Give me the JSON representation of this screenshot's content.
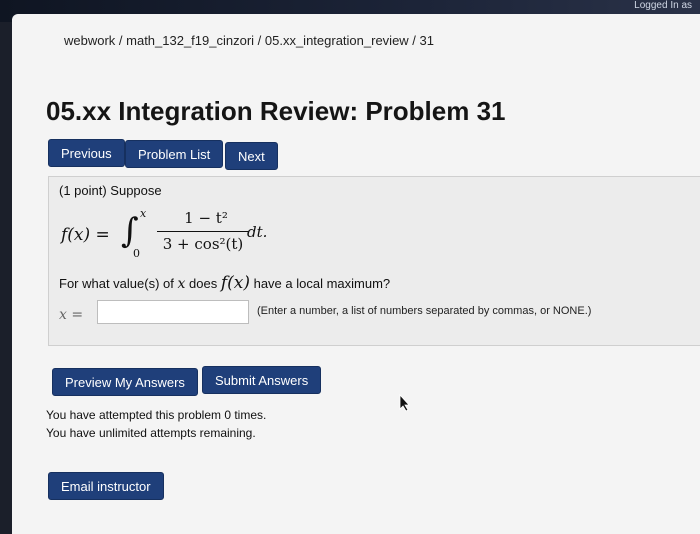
{
  "topbar": {
    "login_text": "Logged In as"
  },
  "breadcrumb": "webwork / math_132_f19_cinzori / 05.xx_integration_review / 31",
  "page_title": "05.xx Integration Review: Problem 31",
  "nav": {
    "previous": "Previous",
    "problem_list": "Problem List",
    "next": "Next"
  },
  "problem": {
    "points_intro": "(1 point) Suppose",
    "formula": {
      "lhs": "f(x) =",
      "integral_sign": "∫",
      "upper_limit": "x",
      "lower_limit": "0",
      "numerator": "1 − t²",
      "denominator": "3 + cos²(t)",
      "differential": "dt."
    },
    "question": {
      "part1": "For what value(s) of ",
      "var": "x",
      "part2": " does ",
      "func": "f(x)",
      "part3": " have a local maximum?"
    },
    "answer_label": "x =",
    "answer_value": "",
    "hint": "(Enter a number, a list of numbers separated by commas, or NONE.)"
  },
  "actions": {
    "preview": "Preview My Answers",
    "submit": "Submit Answers"
  },
  "status": {
    "attempted": "You have attempted this problem 0 times.",
    "remaining": "You have unlimited attempts remaining."
  },
  "email": "Email instructor",
  "colors": {
    "button_bg": "#1f3f7a",
    "page_bg": "#f4f4f4"
  }
}
